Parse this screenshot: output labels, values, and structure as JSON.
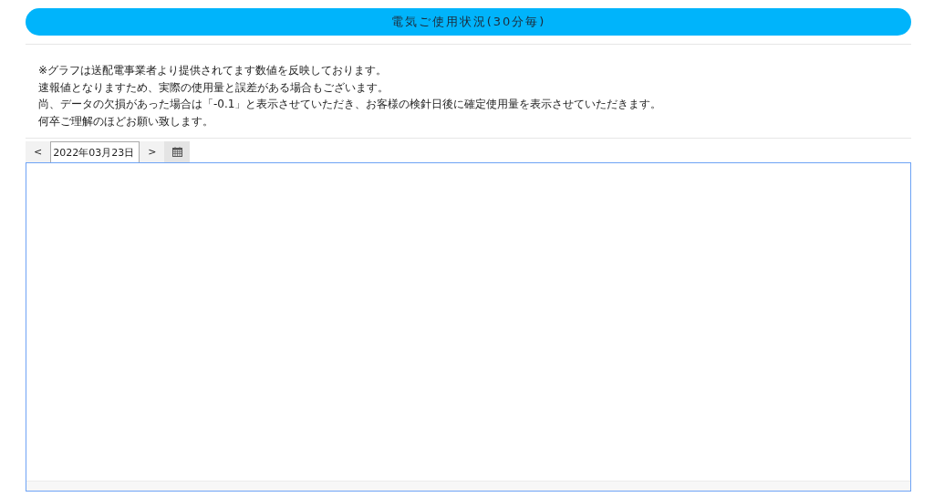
{
  "title": "電気ご使用状況(30分毎)",
  "notes": [
    "※グラフは送配電事業者より提供されてます数値を反映しております。",
    "速報値となりますため、実際の使用量と誤差がある場合もございます。",
    "尚、データの欠損があった場合は「-0.1」と表示させていただき、お客様の検針日後に確定使用量を表示させていただきます。",
    "何卒ご理解のほどお願い致します。"
  ],
  "date_nav": {
    "prev": "<",
    "date": "2022年03月23日",
    "next": ">"
  }
}
